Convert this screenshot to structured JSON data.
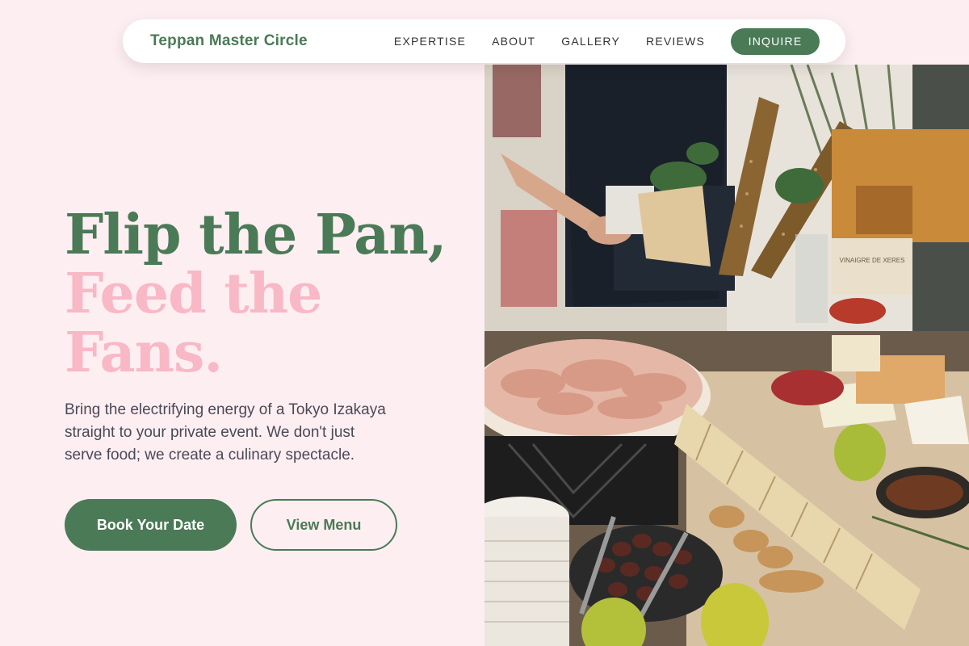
{
  "nav": {
    "brand": "Teppan Master Circle",
    "links": [
      "EXPERTISE",
      "ABOUT",
      "GALLERY",
      "REVIEWS"
    ],
    "cta": "INQUIRE"
  },
  "hero": {
    "headline_line1": "Flip the Pan,",
    "headline_line2": "Feed the",
    "headline_line3": "Fans.",
    "subtext": "Bring the electrifying energy of a Tokyo Izakaya straight to your private event. We don't just serve food; we create a culinary spectacle.",
    "primary_button": "Book Your Date",
    "secondary_button": "View Menu",
    "image_label": "VINAIGRE DE XERES"
  },
  "colors": {
    "primary_green": "#4a7a56",
    "accent_pink": "#f8b8c6",
    "background": "#fdeef2"
  }
}
